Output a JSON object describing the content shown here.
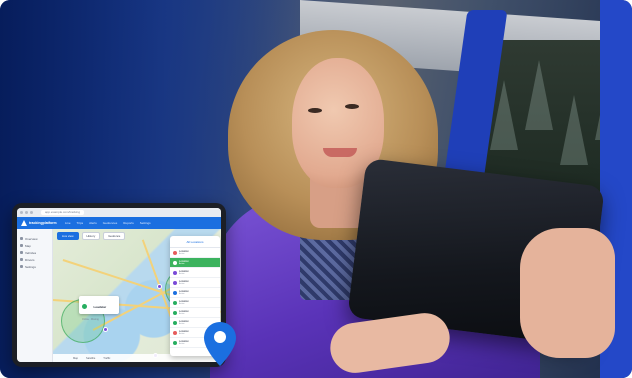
{
  "browser": {
    "url": "app.example.com/tracking"
  },
  "app": {
    "logo_text": "trackingplatform",
    "nav": [
      "Live",
      "Trips",
      "Alerts",
      "Geofences",
      "Reports",
      "Settings"
    ]
  },
  "sidebar": {
    "items": [
      "Overview",
      "Map",
      "Vehicles",
      "Drivers",
      "Settings"
    ]
  },
  "map": {
    "toolbar": [
      "Live view",
      "History",
      "Geofence"
    ],
    "popup": {
      "title": "Loadstar",
      "subtitle": "Online · Moving"
    },
    "footer": [
      "Map",
      "Satellite",
      "Traffic"
    ]
  },
  "list": {
    "header": "All Locations",
    "rows": [
      {
        "name": "Location",
        "meta": "Active",
        "color": "#e65c5c",
        "selected": false
      },
      {
        "name": "Location",
        "meta": "Active",
        "color": "#7a4ad8",
        "selected": true
      },
      {
        "name": "Location",
        "meta": "Active",
        "color": "#7a4ad8",
        "selected": false
      },
      {
        "name": "Location",
        "meta": "Active",
        "color": "#7a4ad8",
        "selected": false
      },
      {
        "name": "Location",
        "meta": "Active",
        "color": "#1b6fe0",
        "selected": false
      },
      {
        "name": "Location",
        "meta": "Active",
        "color": "#27ae60",
        "selected": false
      },
      {
        "name": "Location",
        "meta": "Active",
        "color": "#27ae60",
        "selected": false
      },
      {
        "name": "Location",
        "meta": "Active",
        "color": "#27ae60",
        "selected": false
      },
      {
        "name": "Location",
        "meta": "Active",
        "color": "#e65c5c",
        "selected": false
      },
      {
        "name": "Location",
        "meta": "Active",
        "color": "#27ae60",
        "selected": false
      }
    ]
  },
  "colors": {
    "brand": "#1b6fe0",
    "selected": "#3cb35e",
    "pin": "#1b6fe0"
  },
  "icons": [
    "location-pin-icon",
    "logo-icon"
  ]
}
